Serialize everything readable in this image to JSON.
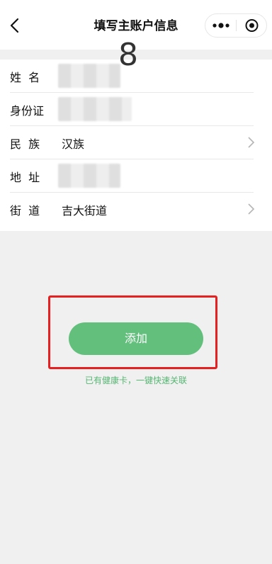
{
  "header": {
    "title": "填写主账户信息",
    "back_icon": "chevron-left-icon",
    "more_icon": "more-icon",
    "target_icon": "target-icon"
  },
  "big_digit": "8",
  "form": {
    "rows": [
      {
        "label": "姓  名",
        "value": "",
        "has_arrow": false
      },
      {
        "label": "身份证",
        "value": "",
        "has_arrow": false
      },
      {
        "label": "民  族",
        "value": "汉族",
        "has_arrow": true
      },
      {
        "label": "地  址",
        "value": "",
        "has_arrow": false
      },
      {
        "label": "街  道",
        "value": "吉大街道",
        "has_arrow": true
      }
    ]
  },
  "actions": {
    "add_label": "添加",
    "hint_text": "已有健康卡，一键快速关联"
  },
  "colors": {
    "accent_green": "#62bf7c",
    "hint_green": "#57b673",
    "highlight_red": "#e62020"
  }
}
